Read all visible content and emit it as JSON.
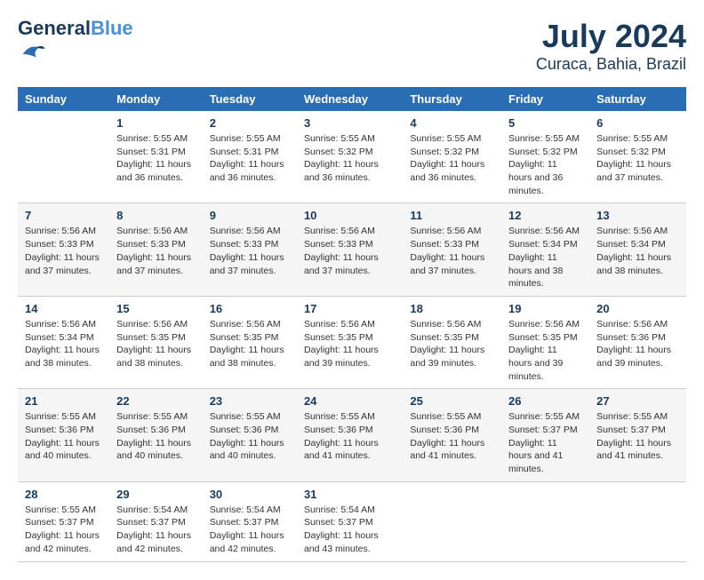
{
  "logo": {
    "line1": "General",
    "line2": "Blue"
  },
  "title": "July 2024",
  "subtitle": "Curaca, Bahia, Brazil",
  "days_of_week": [
    "Sunday",
    "Monday",
    "Tuesday",
    "Wednesday",
    "Thursday",
    "Friday",
    "Saturday"
  ],
  "weeks": [
    [
      null,
      {
        "day": "1",
        "sunrise": "5:55 AM",
        "sunset": "5:31 PM",
        "daylight": "11 hours and 36 minutes."
      },
      {
        "day": "2",
        "sunrise": "5:55 AM",
        "sunset": "5:31 PM",
        "daylight": "11 hours and 36 minutes."
      },
      {
        "day": "3",
        "sunrise": "5:55 AM",
        "sunset": "5:32 PM",
        "daylight": "11 hours and 36 minutes."
      },
      {
        "day": "4",
        "sunrise": "5:55 AM",
        "sunset": "5:32 PM",
        "daylight": "11 hours and 36 minutes."
      },
      {
        "day": "5",
        "sunrise": "5:55 AM",
        "sunset": "5:32 PM",
        "daylight": "11 hours and 36 minutes."
      },
      {
        "day": "6",
        "sunrise": "5:55 AM",
        "sunset": "5:32 PM",
        "daylight": "11 hours and 37 minutes."
      }
    ],
    [
      {
        "day": "7",
        "sunrise": "5:56 AM",
        "sunset": "5:33 PM",
        "daylight": "11 hours and 37 minutes."
      },
      {
        "day": "8",
        "sunrise": "5:56 AM",
        "sunset": "5:33 PM",
        "daylight": "11 hours and 37 minutes."
      },
      {
        "day": "9",
        "sunrise": "5:56 AM",
        "sunset": "5:33 PM",
        "daylight": "11 hours and 37 minutes."
      },
      {
        "day": "10",
        "sunrise": "5:56 AM",
        "sunset": "5:33 PM",
        "daylight": "11 hours and 37 minutes."
      },
      {
        "day": "11",
        "sunrise": "5:56 AM",
        "sunset": "5:33 PM",
        "daylight": "11 hours and 37 minutes."
      },
      {
        "day": "12",
        "sunrise": "5:56 AM",
        "sunset": "5:34 PM",
        "daylight": "11 hours and 38 minutes."
      },
      {
        "day": "13",
        "sunrise": "5:56 AM",
        "sunset": "5:34 PM",
        "daylight": "11 hours and 38 minutes."
      }
    ],
    [
      {
        "day": "14",
        "sunrise": "5:56 AM",
        "sunset": "5:34 PM",
        "daylight": "11 hours and 38 minutes."
      },
      {
        "day": "15",
        "sunrise": "5:56 AM",
        "sunset": "5:35 PM",
        "daylight": "11 hours and 38 minutes."
      },
      {
        "day": "16",
        "sunrise": "5:56 AM",
        "sunset": "5:35 PM",
        "daylight": "11 hours and 38 minutes."
      },
      {
        "day": "17",
        "sunrise": "5:56 AM",
        "sunset": "5:35 PM",
        "daylight": "11 hours and 39 minutes."
      },
      {
        "day": "18",
        "sunrise": "5:56 AM",
        "sunset": "5:35 PM",
        "daylight": "11 hours and 39 minutes."
      },
      {
        "day": "19",
        "sunrise": "5:56 AM",
        "sunset": "5:35 PM",
        "daylight": "11 hours and 39 minutes."
      },
      {
        "day": "20",
        "sunrise": "5:56 AM",
        "sunset": "5:36 PM",
        "daylight": "11 hours and 39 minutes."
      }
    ],
    [
      {
        "day": "21",
        "sunrise": "5:55 AM",
        "sunset": "5:36 PM",
        "daylight": "11 hours and 40 minutes."
      },
      {
        "day": "22",
        "sunrise": "5:55 AM",
        "sunset": "5:36 PM",
        "daylight": "11 hours and 40 minutes."
      },
      {
        "day": "23",
        "sunrise": "5:55 AM",
        "sunset": "5:36 PM",
        "daylight": "11 hours and 40 minutes."
      },
      {
        "day": "24",
        "sunrise": "5:55 AM",
        "sunset": "5:36 PM",
        "daylight": "11 hours and 41 minutes."
      },
      {
        "day": "25",
        "sunrise": "5:55 AM",
        "sunset": "5:36 PM",
        "daylight": "11 hours and 41 minutes."
      },
      {
        "day": "26",
        "sunrise": "5:55 AM",
        "sunset": "5:37 PM",
        "daylight": "11 hours and 41 minutes."
      },
      {
        "day": "27",
        "sunrise": "5:55 AM",
        "sunset": "5:37 PM",
        "daylight": "11 hours and 41 minutes."
      }
    ],
    [
      {
        "day": "28",
        "sunrise": "5:55 AM",
        "sunset": "5:37 PM",
        "daylight": "11 hours and 42 minutes."
      },
      {
        "day": "29",
        "sunrise": "5:54 AM",
        "sunset": "5:37 PM",
        "daylight": "11 hours and 42 minutes."
      },
      {
        "day": "30",
        "sunrise": "5:54 AM",
        "sunset": "5:37 PM",
        "daylight": "11 hours and 42 minutes."
      },
      {
        "day": "31",
        "sunrise": "5:54 AM",
        "sunset": "5:37 PM",
        "daylight": "11 hours and 43 minutes."
      },
      null,
      null,
      null
    ]
  ]
}
